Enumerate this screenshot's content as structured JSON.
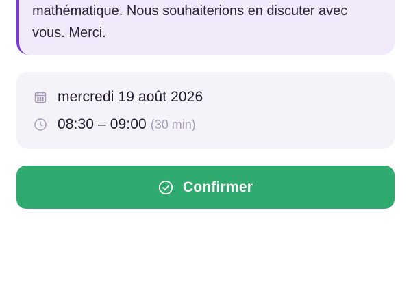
{
  "message": {
    "text": "mathématique. Nous souhaiterions en discuter avec vous. Merci."
  },
  "appointment": {
    "date": "mercredi 19 août 2026",
    "time": "08:30 – 09:00",
    "duration": "(30 min)",
    "date_icon": "calendar-icon",
    "time_icon": "clock-icon"
  },
  "actions": {
    "confirm_label": "Confirmer",
    "confirm_icon": "check-circle-icon"
  },
  "colors": {
    "accent": "#7a3ad8",
    "message_bg": "#f2e9fa",
    "details_bg": "#f5f3fa",
    "confirm_bg": "#2fab6f",
    "muted_text": "#a79bb8"
  }
}
